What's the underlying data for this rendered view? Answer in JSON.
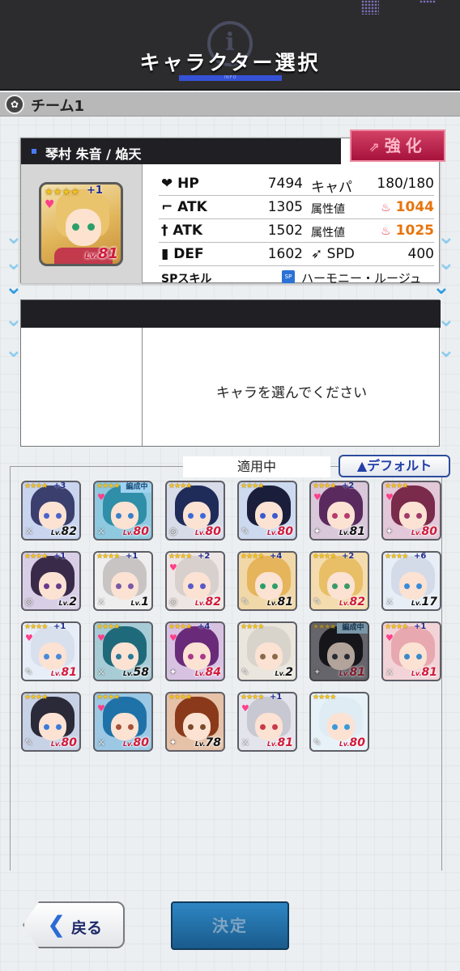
{
  "header": {
    "title": "キャラクター選択",
    "sub": "INFO"
  },
  "team": {
    "name": "チーム1"
  },
  "character": {
    "name": "琴村 朱音 / 焔天",
    "level": "81",
    "plus": "+1",
    "enhance_label": "強化",
    "stats": {
      "hp_label": "HP",
      "hp": "7494",
      "capa_label": "キャパ",
      "capa": "180/180",
      "atk1_label": "ATK",
      "atk1": "1305",
      "attr1_label": "属性値",
      "attr1": "1044",
      "atk2_label": "ATK",
      "atk2": "1502",
      "attr2_label": "属性値",
      "attr2": "1025",
      "def_label": "DEF",
      "def": "1602",
      "spd_label": "SPD",
      "spd": "400",
      "sp_label": "SPスキル",
      "sp_badge": "SP",
      "sp_value": "ハーモニー・ルージュ"
    }
  },
  "select": {
    "message": "キャラを選んでください"
  },
  "list": {
    "applying_label": "適用中",
    "default_label": "▲デフォルト",
    "cards": [
      {
        "level": "82",
        "plus": "+3",
        "heart": false,
        "badge": "",
        "lv": "black",
        "hair": "#3a3f6e",
        "eye": "#4a63c8",
        "bg": "#c9d4ef",
        "weapon": "⚔",
        "dim": false
      },
      {
        "level": "80",
        "plus": "",
        "heart": true,
        "badge": "編成中",
        "lv": "red",
        "hair": "#2f8ea8",
        "eye": "#3a80c8",
        "bg": "#8fc9e0",
        "weapon": "⚔",
        "dim": false
      },
      {
        "level": "80",
        "plus": "",
        "heart": false,
        "badge": "",
        "lv": "red",
        "hair": "#1f2c5a",
        "eye": "#3a6ad8",
        "bg": "#d8dce8",
        "weapon": "◎",
        "dim": false
      },
      {
        "level": "80",
        "plus": "",
        "heart": false,
        "badge": "",
        "lv": "red",
        "hair": "#1a1e3a",
        "eye": "#3a5ad0",
        "bg": "#cdd9ee",
        "weapon": "✎",
        "dim": false
      },
      {
        "level": "81",
        "plus": "+2",
        "heart": true,
        "badge": "",
        "lv": "black",
        "hair": "#5a2a5e",
        "eye": "#b83a6a",
        "bg": "#d8c8da",
        "weapon": "✦",
        "dim": false
      },
      {
        "level": "80",
        "plus": "",
        "heart": true,
        "badge": "",
        "lv": "red",
        "hair": "#7a2a4a",
        "eye": "#a03a6a",
        "bg": "#e2c8d8",
        "weapon": "✦",
        "dim": false
      },
      {
        "level": "2",
        "plus": "+1",
        "heart": false,
        "badge": "",
        "lv": "black",
        "hair": "#3a2a4a",
        "eye": "#6a3a8a",
        "bg": "#d8cfe6",
        "weapon": "◎",
        "dim": false
      },
      {
        "level": "1",
        "plus": "+1",
        "heart": false,
        "badge": "",
        "lv": "black",
        "hair": "#c8c4c4",
        "eye": "#7a5aa8",
        "bg": "#eeeeee",
        "weapon": "⚔",
        "dim": false
      },
      {
        "level": "82",
        "plus": "+2",
        "heart": true,
        "badge": "",
        "lv": "red",
        "hair": "#d8d0cc",
        "eye": "#5a5ac8",
        "bg": "#eee6e4",
        "weapon": "◎",
        "dim": false
      },
      {
        "level": "81",
        "plus": "+4",
        "heart": false,
        "badge": "",
        "lv": "black",
        "hair": "#e6b45a",
        "eye": "#2d9e6a",
        "bg": "#f0d8a8",
        "weapon": "✎",
        "dim": false
      },
      {
        "level": "82",
        "plus": "+2",
        "heart": false,
        "badge": "",
        "lv": "red",
        "hair": "#e8bf66",
        "eye": "#3a9a6a",
        "bg": "#f4dcae",
        "weapon": "✎",
        "dim": false
      },
      {
        "level": "17",
        "plus": "+6",
        "heart": false,
        "badge": "",
        "lv": "black",
        "hair": "#d4dbe8",
        "eye": "#3a8ad8",
        "bg": "#e8eef6",
        "weapon": "⚔",
        "dim": false
      },
      {
        "level": "81",
        "plus": "+1",
        "heart": true,
        "badge": "",
        "lv": "red",
        "hair": "#d8e0ee",
        "eye": "#4a8ad8",
        "bg": "#e8eef8",
        "weapon": "✎",
        "dim": false
      },
      {
        "level": "58",
        "plus": "",
        "heart": true,
        "badge": "",
        "lv": "black",
        "hair": "#1f6a7a",
        "eye": "#2a7a9a",
        "bg": "#a8ccd6",
        "weapon": "⚔",
        "dim": false
      },
      {
        "level": "84",
        "plus": "+4",
        "heart": true,
        "badge": "",
        "lv": "red",
        "hair": "#6a2a7a",
        "eye": "#a83a8a",
        "bg": "#d8c2e2",
        "weapon": "✦",
        "dim": false
      },
      {
        "level": "2",
        "plus": "",
        "heart": false,
        "badge": "",
        "lv": "black",
        "hair": "#d8d4cc",
        "eye": "#8a6a4a",
        "bg": "#eae6de",
        "weapon": "✎",
        "dim": false
      },
      {
        "level": "81",
        "plus": "",
        "heart": false,
        "badge": "編成中",
        "lv": "red",
        "hair": "#1e1e26",
        "eye": "#3a3a4a",
        "bg": "#8c8c96",
        "weapon": "✦",
        "dim": true
      },
      {
        "level": "81",
        "plus": "+1",
        "heart": true,
        "badge": "",
        "lv": "red",
        "hair": "#e8a8b0",
        "eye": "#3a8ac8",
        "bg": "#f2d4d8",
        "weapon": "⚔",
        "dim": false
      },
      {
        "level": "80",
        "plus": "",
        "heart": false,
        "badge": "",
        "lv": "red",
        "hair": "#2a2a38",
        "eye": "#3a7ad8",
        "bg": "#c8d2e6",
        "weapon": "✎",
        "dim": false
      },
      {
        "level": "80",
        "plus": "",
        "heart": true,
        "badge": "",
        "lv": "red",
        "hair": "#1f72a8",
        "eye": "#a8503a",
        "bg": "#9cc8e4",
        "weapon": "⚔",
        "dim": false
      },
      {
        "level": "78",
        "plus": "",
        "heart": false,
        "badge": "",
        "lv": "black",
        "hair": "#8a3a1a",
        "eye": "#7a4a2a",
        "bg": "#e6c2a8",
        "weapon": "✦",
        "dim": false
      },
      {
        "level": "81",
        "plus": "+1",
        "heart": true,
        "badge": "",
        "lv": "red",
        "hair": "#c8c8d2",
        "eye": "#c83a4a",
        "bg": "#e4e4ec",
        "weapon": "⚔",
        "dim": false
      },
      {
        "level": "80",
        "plus": "",
        "heart": false,
        "badge": "",
        "lv": "red",
        "hair": "#e0ecf4",
        "eye": "#3a9ad8",
        "bg": "#e6f2f8",
        "weapon": "✎",
        "dim": false
      }
    ]
  },
  "footer": {
    "back_label": "戻る",
    "ok_label": "決定"
  },
  "colors": {
    "accent_blue": "#3552d6",
    "enhance": "#c0284f",
    "orange_value": "#e8740e"
  }
}
